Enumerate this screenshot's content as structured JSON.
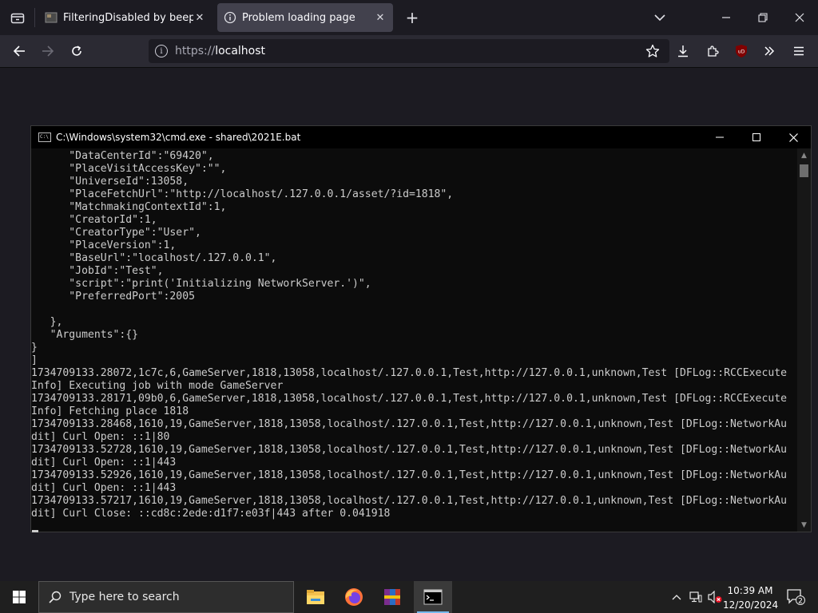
{
  "browser": {
    "tabs": [
      {
        "title": "FilteringDisabled by beepboop",
        "active": false,
        "favicon": "site-icon"
      },
      {
        "title": "Problem loading page",
        "active": true,
        "favicon": "info-icon"
      }
    ],
    "url": {
      "scheme": "https://",
      "host": "localhost"
    },
    "addon_badge": "uD"
  },
  "cmd": {
    "title": "C:\\Windows\\system32\\cmd.exe - shared\\2021E.bat",
    "lines": [
      "      \"DataCenterId\":\"69420\",",
      "      \"PlaceVisitAccessKey\":\"\",",
      "      \"UniverseId\":13058,",
      "      \"PlaceFetchUrl\":\"http://localhost/.127.0.0.1/asset/?id=1818\",",
      "      \"MatchmakingContextId\":1,",
      "      \"CreatorId\":1,",
      "      \"CreatorType\":\"User\",",
      "      \"PlaceVersion\":1,",
      "      \"BaseUrl\":\"localhost/.127.0.0.1\",",
      "      \"JobId\":\"Test\",",
      "      \"script\":\"print('Initializing NetworkServer.')\",",
      "      \"PreferredPort\":2005",
      "",
      "   },",
      "   \"Arguments\":{}",
      "}",
      "]",
      "1734709133.28072,1c7c,6,GameServer,1818,13058,localhost/.127.0.0.1,Test,http://127.0.0.1,unknown,Test [DFLog::RCCExecute",
      "Info] Executing job with mode GameServer",
      "1734709133.28171,09b0,6,GameServer,1818,13058,localhost/.127.0.0.1,Test,http://127.0.0.1,unknown,Test [DFLog::RCCExecute",
      "Info] Fetching place 1818",
      "1734709133.28468,1610,19,GameServer,1818,13058,localhost/.127.0.0.1,Test,http://127.0.0.1,unknown,Test [DFLog::NetworkAu",
      "dit] Curl Open: ::1|80",
      "1734709133.52728,1610,19,GameServer,1818,13058,localhost/.127.0.0.1,Test,http://127.0.0.1,unknown,Test [DFLog::NetworkAu",
      "dit] Curl Open: ::1|443",
      "1734709133.52926,1610,19,GameServer,1818,13058,localhost/.127.0.0.1,Test,http://127.0.0.1,unknown,Test [DFLog::NetworkAu",
      "dit] Curl Open: ::1|443",
      "1734709133.57217,1610,19,GameServer,1818,13058,localhost/.127.0.0.1,Test,http://127.0.0.1,unknown,Test [DFLog::NetworkAu",
      "dit] Curl Close: ::cd8c:2ede:d1f7:e03f|443 after 0.041918"
    ]
  },
  "taskbar": {
    "search_placeholder": "Type here to search",
    "apps": [
      "file-explorer-icon",
      "firefox-icon",
      "winrar-icon",
      "cmd-icon"
    ],
    "clock": {
      "time": "10:39 AM",
      "date": "12/20/2024"
    },
    "notification_count": "2"
  },
  "colors": {
    "browser_bg": "#1c1b22",
    "toolbar_bg": "#2b2a33",
    "active_tab": "#42414d",
    "console_bg": "#0c0c0c",
    "console_text": "#cccccc",
    "taskbar_bg": "#1f1f1f",
    "taskbar_accent": "#76b9ed"
  }
}
